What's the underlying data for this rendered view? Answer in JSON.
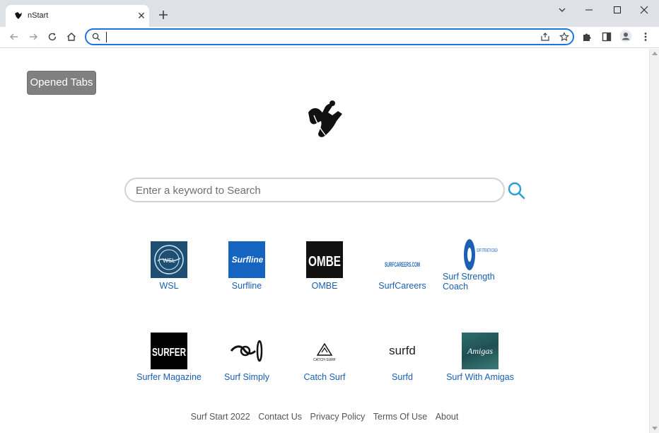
{
  "browser": {
    "tab_title": "nStart",
    "new_tab_icon": "plus-icon",
    "omnibox_value": "",
    "window_controls": [
      "chevron-down-icon",
      "minimize-icon",
      "maximize-icon",
      "close-icon"
    ]
  },
  "page": {
    "opened_tabs_label": "Opened Tabs",
    "search_placeholder": "Enter a keyword to Search",
    "tiles": [
      {
        "label": "WSL",
        "thumb_text": "WSL"
      },
      {
        "label": "Surfline",
        "thumb_text": "Surfline"
      },
      {
        "label": "OMBE",
        "thumb_text": "OMBE"
      },
      {
        "label": "SurfCareers",
        "thumb_text": "SURFCAREERS.COM"
      },
      {
        "label": "Surf Strength Coach",
        "thumb_text": "SURF STRENGTH COACH"
      },
      {
        "label": "Surfer Magazine",
        "thumb_text": "SURFER"
      },
      {
        "label": "Surf Simply",
        "thumb_text": ""
      },
      {
        "label": "Catch Surf",
        "thumb_text": "CATCH SURF"
      },
      {
        "label": "Surfd",
        "thumb_text": "surfd"
      },
      {
        "label": "Surf With Amigas",
        "thumb_text": "Amigas"
      }
    ],
    "footer": {
      "copyright": "Surf Start 2022",
      "contact": "Contact Us",
      "privacy": "Privacy Policy",
      "terms": "Terms Of Use",
      "about": "About"
    }
  },
  "colors": {
    "accent": "#1a73e8",
    "link": "#1a5fb4",
    "search_icon": "#2a9fd6",
    "button_bg": "#808080"
  }
}
